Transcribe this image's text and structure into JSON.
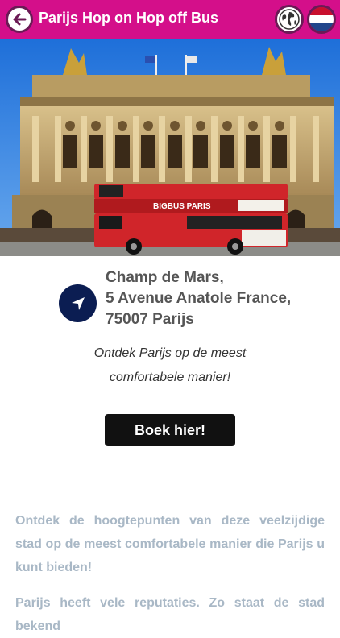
{
  "header": {
    "title": "Parijs Hop on Hop off Bus"
  },
  "location": {
    "line1": "Champ de Mars,",
    "line2": "5 Avenue Anatole France,",
    "line3": "75007 Parijs"
  },
  "tagline": {
    "line1": "Ontdek Parijs op de meest",
    "line2": "comfortabele manier!"
  },
  "book_button": "Boek hier!",
  "hero": {
    "bus_sign": "BIGBUS PARIS"
  },
  "body": {
    "paragraph1": "Ontdek de hoogtepunten van deze veelzijdige stad op de meest comfortabele manier die Parijs u kunt bieden!",
    "paragraph2": "Parijs heeft vele reputaties. Zo staat de stad bekend"
  },
  "colors": {
    "header_bg": "#d40f8a",
    "nav_circle": "#0b1d52",
    "button_bg": "#111111",
    "body_text": "#a9b8c6"
  }
}
